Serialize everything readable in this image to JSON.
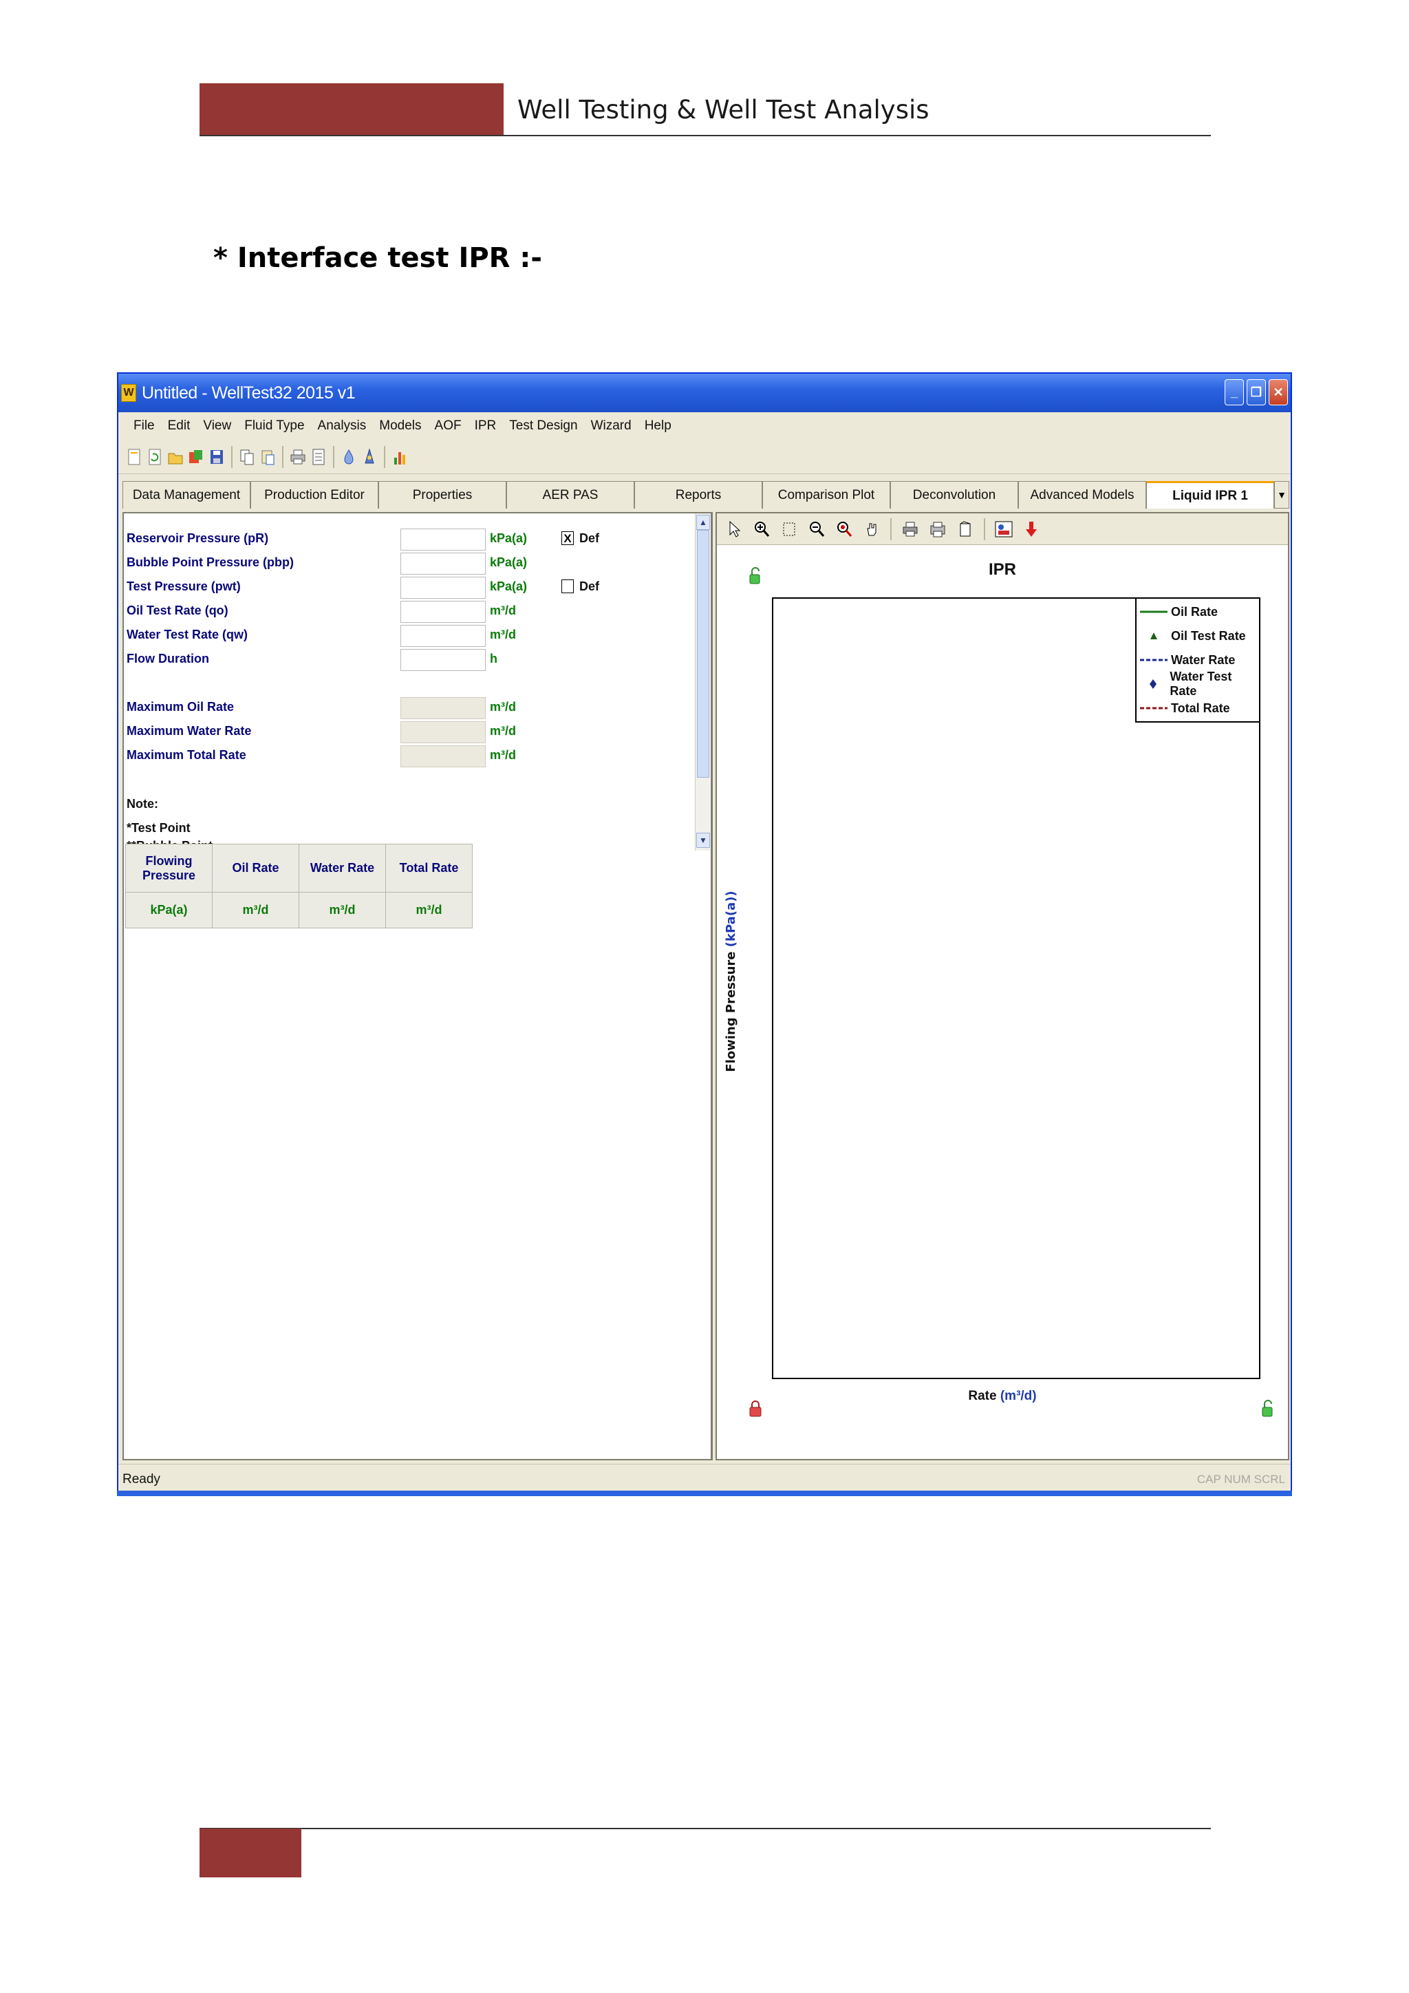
{
  "page": {
    "header_title": "Well Testing & Well Test Analysis",
    "section_title": "*  Interface test IPR :-"
  },
  "window": {
    "title": "Untitled - WellTest32 2015 v1",
    "app_icon": "W",
    "menu": [
      "File",
      "Edit",
      "View",
      "Fluid Type",
      "Analysis",
      "Models",
      "AOF",
      "IPR",
      "Test Design",
      "Wizard",
      "Help"
    ],
    "tabs": [
      "Data Management",
      "Production Editor",
      "Properties",
      "AER PAS",
      "Reports",
      "Comparison Plot",
      "Deconvolution",
      "Advanced Models",
      "Liquid IPR 1"
    ],
    "active_tab": "Liquid IPR 1"
  },
  "form": {
    "reservoir_pressure": {
      "label": "Reservoir Pressure (pR)",
      "value": "",
      "unit": "kPa(a)",
      "def_checked": true,
      "def_label": "Def"
    },
    "bubble_point_pressure": {
      "label": "Bubble Point Pressure (pbp)",
      "value": "",
      "unit": "kPa(a)"
    },
    "test_pressure": {
      "label": "Test Pressure (pwt)",
      "value": "",
      "unit": "kPa(a)",
      "def_checked": false,
      "def_label": "Def"
    },
    "oil_test_rate": {
      "label": "Oil Test Rate (qo)",
      "value": "",
      "unit": "m³/d"
    },
    "water_test_rate": {
      "label": "Water Test Rate (qw)",
      "value": "",
      "unit": "m³/d"
    },
    "flow_duration": {
      "label": "Flow Duration",
      "value": "",
      "unit": "h"
    },
    "max_oil_rate": {
      "label": "Maximum Oil Rate",
      "value": "",
      "unit": "m³/d"
    },
    "max_water_rate": {
      "label": "Maximum Water Rate",
      "value": "",
      "unit": "m³/d"
    },
    "max_total_rate": {
      "label": "Maximum Total Rate",
      "value": "",
      "unit": "m³/d"
    },
    "note_title": "Note:",
    "note_1": "*Test Point",
    "note_2": "**Bubble Point"
  },
  "table": {
    "headers": [
      "Flowing Pressure",
      "Oil Rate",
      "Water Rate",
      "Total Rate"
    ],
    "units": [
      "kPa(a)",
      "m³/d",
      "m³/d",
      "m³/d"
    ]
  },
  "plot": {
    "title": "IPR",
    "ylabel_text": "Flowing Pressure ",
    "ylabel_unit": "(kPa(a))",
    "xlabel_text": "Rate ",
    "xlabel_unit": "(m³/d)",
    "legend": [
      {
        "label": "Oil Rate",
        "color": "#1b7a1b",
        "style": "solid-line"
      },
      {
        "label": "Oil Test Rate",
        "color": "#1b5e1b",
        "style": "triangle"
      },
      {
        "label": "Water Rate",
        "color": "#1a2a8a",
        "style": "dashed-line"
      },
      {
        "label": "Water Test Rate",
        "color": "#1a2a8a",
        "style": "diamond"
      },
      {
        "label": "Total Rate",
        "color": "#8a1a1a",
        "style": "dashed-line"
      }
    ]
  },
  "status": {
    "left": "Ready",
    "right": "CAP NUM SCRL"
  }
}
